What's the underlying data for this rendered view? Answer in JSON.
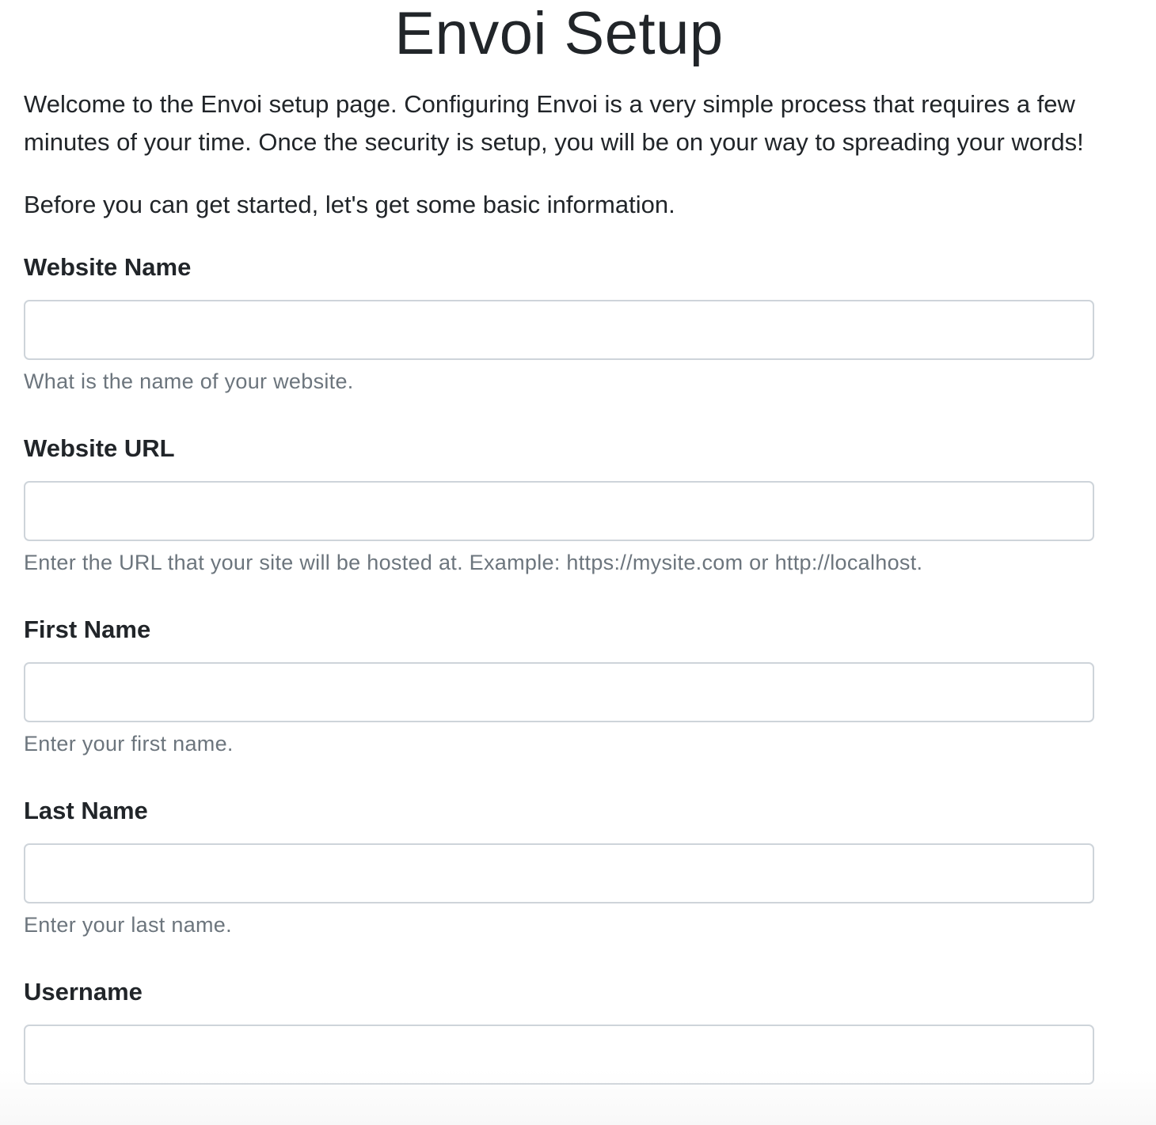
{
  "header": {
    "title": "Envoi Setup"
  },
  "intro": {
    "welcome": "Welcome to the Envoi setup page. Configuring Envoi is a very simple process that requires a few minutes of your time. Once the security is setup, you will be on your way to spreading your words!",
    "basic_info": "Before you can get started, let's get some basic information."
  },
  "form": {
    "fields": [
      {
        "label": "Website Name",
        "value": "",
        "help": "What is the name of your website."
      },
      {
        "label": "Website URL",
        "value": "",
        "help": "Enter the URL that your site will be hosted at. Example: https://mysite.com or http://localhost."
      },
      {
        "label": "First Name",
        "value": "",
        "help": "Enter your first name."
      },
      {
        "label": "Last Name",
        "value": "",
        "help": "Enter your last name."
      },
      {
        "label": "Username",
        "value": ""
      }
    ]
  },
  "colors": {
    "text": "#212529",
    "muted": "#6c757d",
    "input_border": "#ced4da"
  }
}
